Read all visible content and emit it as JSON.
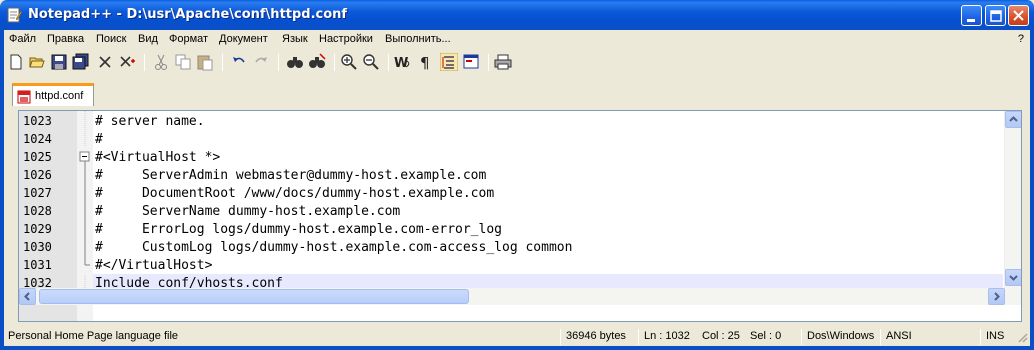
{
  "window": {
    "title": "Notepad++ - D:\\usr\\Apache\\conf\\httpd.conf",
    "colors": {
      "titlebar": "#0a5fe0",
      "close": "#d8502a",
      "tab_accent": "#fa9c1a",
      "current_line": "#e8e8ff"
    }
  },
  "menu": {
    "items": [
      "Файл",
      "Правка",
      "Поиск",
      "Вид",
      "Формат",
      "Документ",
      "Язык",
      "Настройки",
      "Выполнить..."
    ],
    "help": "?"
  },
  "toolbar": {
    "icons": [
      "new-icon",
      "open-icon",
      "save-icon",
      "save-all-icon",
      "close-icon",
      "close-all-icon",
      "cut-icon",
      "copy-icon",
      "paste-icon",
      "undo-icon",
      "redo-icon",
      "find-icon",
      "replace-icon",
      "zoom-in-icon",
      "zoom-out-icon",
      "word-wrap-icon",
      "show-all-chars-icon",
      "indent-guide-icon",
      "user-defined-dialog-icon",
      "print-icon"
    ]
  },
  "tabs": [
    {
      "label": "httpd.conf"
    }
  ],
  "editor": {
    "lines": [
      {
        "num": "1023",
        "text": "# server name."
      },
      {
        "num": "1024",
        "text": "#"
      },
      {
        "num": "1025",
        "text": "#<VirtualHost *>"
      },
      {
        "num": "1026",
        "text": "#     ServerAdmin webmaster@dummy-host.example.com"
      },
      {
        "num": "1027",
        "text": "#     DocumentRoot /www/docs/dummy-host.example.com"
      },
      {
        "num": "1028",
        "text": "#     ServerName dummy-host.example.com"
      },
      {
        "num": "1029",
        "text": "#     ErrorLog logs/dummy-host.example.com-error_log"
      },
      {
        "num": "1030",
        "text": "#     CustomLog logs/dummy-host.example.com-access_log common"
      },
      {
        "num": "1031",
        "text": "#</VirtualHost>"
      },
      {
        "num": "1032",
        "text": "Include conf/vhosts.conf"
      }
    ]
  },
  "status": {
    "language": "Personal Home Page language file",
    "size": "36946 bytes",
    "ln": "Ln : 1032",
    "col": "Col : 25",
    "sel": "Sel : 0",
    "eol": "Dos\\Windows",
    "encoding": "ANSI",
    "mode": "INS"
  }
}
